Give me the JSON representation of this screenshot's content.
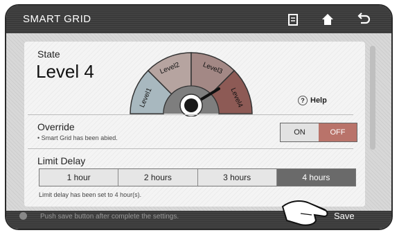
{
  "header": {
    "title": "SMART GRID",
    "icons": [
      "manual-icon",
      "home-icon",
      "back-icon"
    ]
  },
  "state": {
    "label": "State",
    "value": "Level 4"
  },
  "gauge": {
    "levels": [
      "Level1",
      "Level2",
      "Level3",
      "Level4"
    ],
    "current_level": 4,
    "colors": {
      "level1": "#a8b8bf",
      "level2": "#b6a4a0",
      "level3": "#a38885",
      "level4": "#8d5a55"
    }
  },
  "help": {
    "label": "Help"
  },
  "override": {
    "label": "Override",
    "note": "• Smart Grid has been abied.",
    "on_label": "ON",
    "off_label": "OFF",
    "selected": "OFF"
  },
  "limit_delay": {
    "label": "Limit Delay",
    "options": [
      "1 hour",
      "2 hours",
      "3 hours",
      "4 hours"
    ],
    "selected": "4 hours",
    "note": "Limit delay has been set to 4 hour(s)."
  },
  "footer": {
    "hint": "Push save button after complete the settings.",
    "save_label": "Save"
  },
  "colors": {
    "accent_off": "#b9736a",
    "selected_segment": "#6a6a6a",
    "bar": "#3a3a3a"
  }
}
